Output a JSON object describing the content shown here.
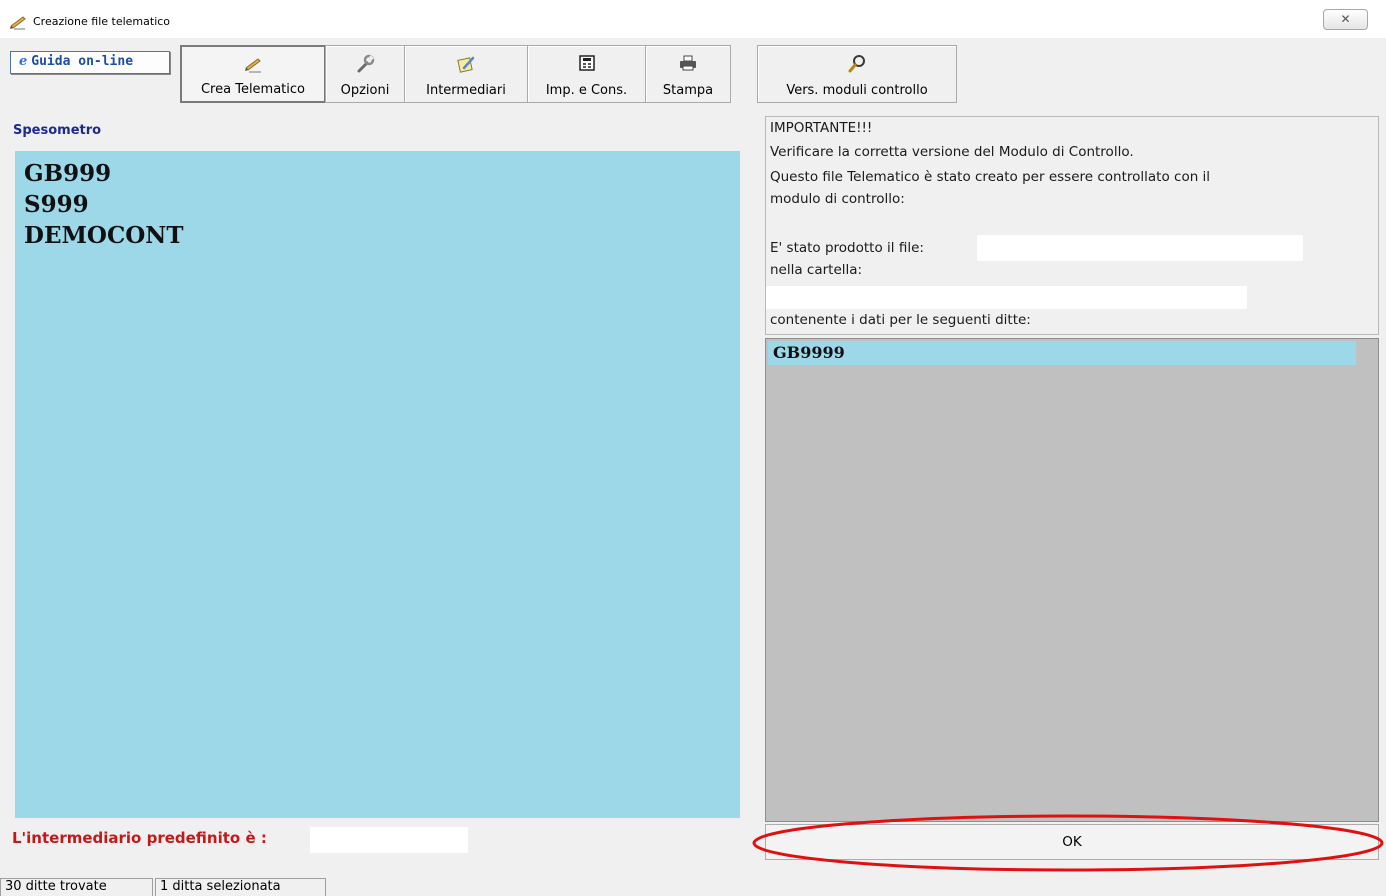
{
  "window": {
    "title": "Creazione file telematico",
    "close_glyph": "✕",
    "icon": "pencil-document-icon"
  },
  "toolbar": {
    "guida_label": "Guida on-line",
    "buttons": [
      {
        "label": "Crea Telematico",
        "icon": "pencil-document-icon"
      },
      {
        "label": "Opzioni",
        "icon": "wrench-icon"
      },
      {
        "label": "Intermediari",
        "icon": "notepad-icon"
      },
      {
        "label": "Imp. e Cons.",
        "icon": "calculator-icon"
      },
      {
        "label": "Stampa",
        "icon": "printer-icon"
      }
    ],
    "vers_button": {
      "label": "Vers. moduli controllo",
      "icon": "magnifier-icon"
    }
  },
  "left": {
    "section_label": "Spesometro",
    "lines": [
      "GB999",
      "S999",
      "DEMOCONT"
    ]
  },
  "right": {
    "info": {
      "important": "IMPORTANTE!!!",
      "verify": "Verificare la corretta versione del Modulo di Controllo.",
      "created_line1": "Questo file Telematico è stato creato per essere controllato con il",
      "created_line2": "modulo di controllo:",
      "file_label": "E' stato prodotto il file:",
      "folder_label": "nella cartella:",
      "ditte_label": "contenente i dati per le seguenti ditte:",
      "file_value": "",
      "folder_value": ""
    },
    "list_items": [
      "GB9999"
    ],
    "ok_label": "OK"
  },
  "bottom": {
    "intermediario_label": "L'intermediario predefinito è :",
    "intermediario_value": ""
  },
  "status": {
    "found": "30 ditte trovate",
    "selected": "1 ditta selezionata"
  },
  "colors": {
    "panel_blue": "#9cd8e8",
    "list_gray": "#c0c0c0",
    "label_red": "#c4191b",
    "label_navy": "#1c2b8e",
    "annotation_red": "#e01010"
  }
}
